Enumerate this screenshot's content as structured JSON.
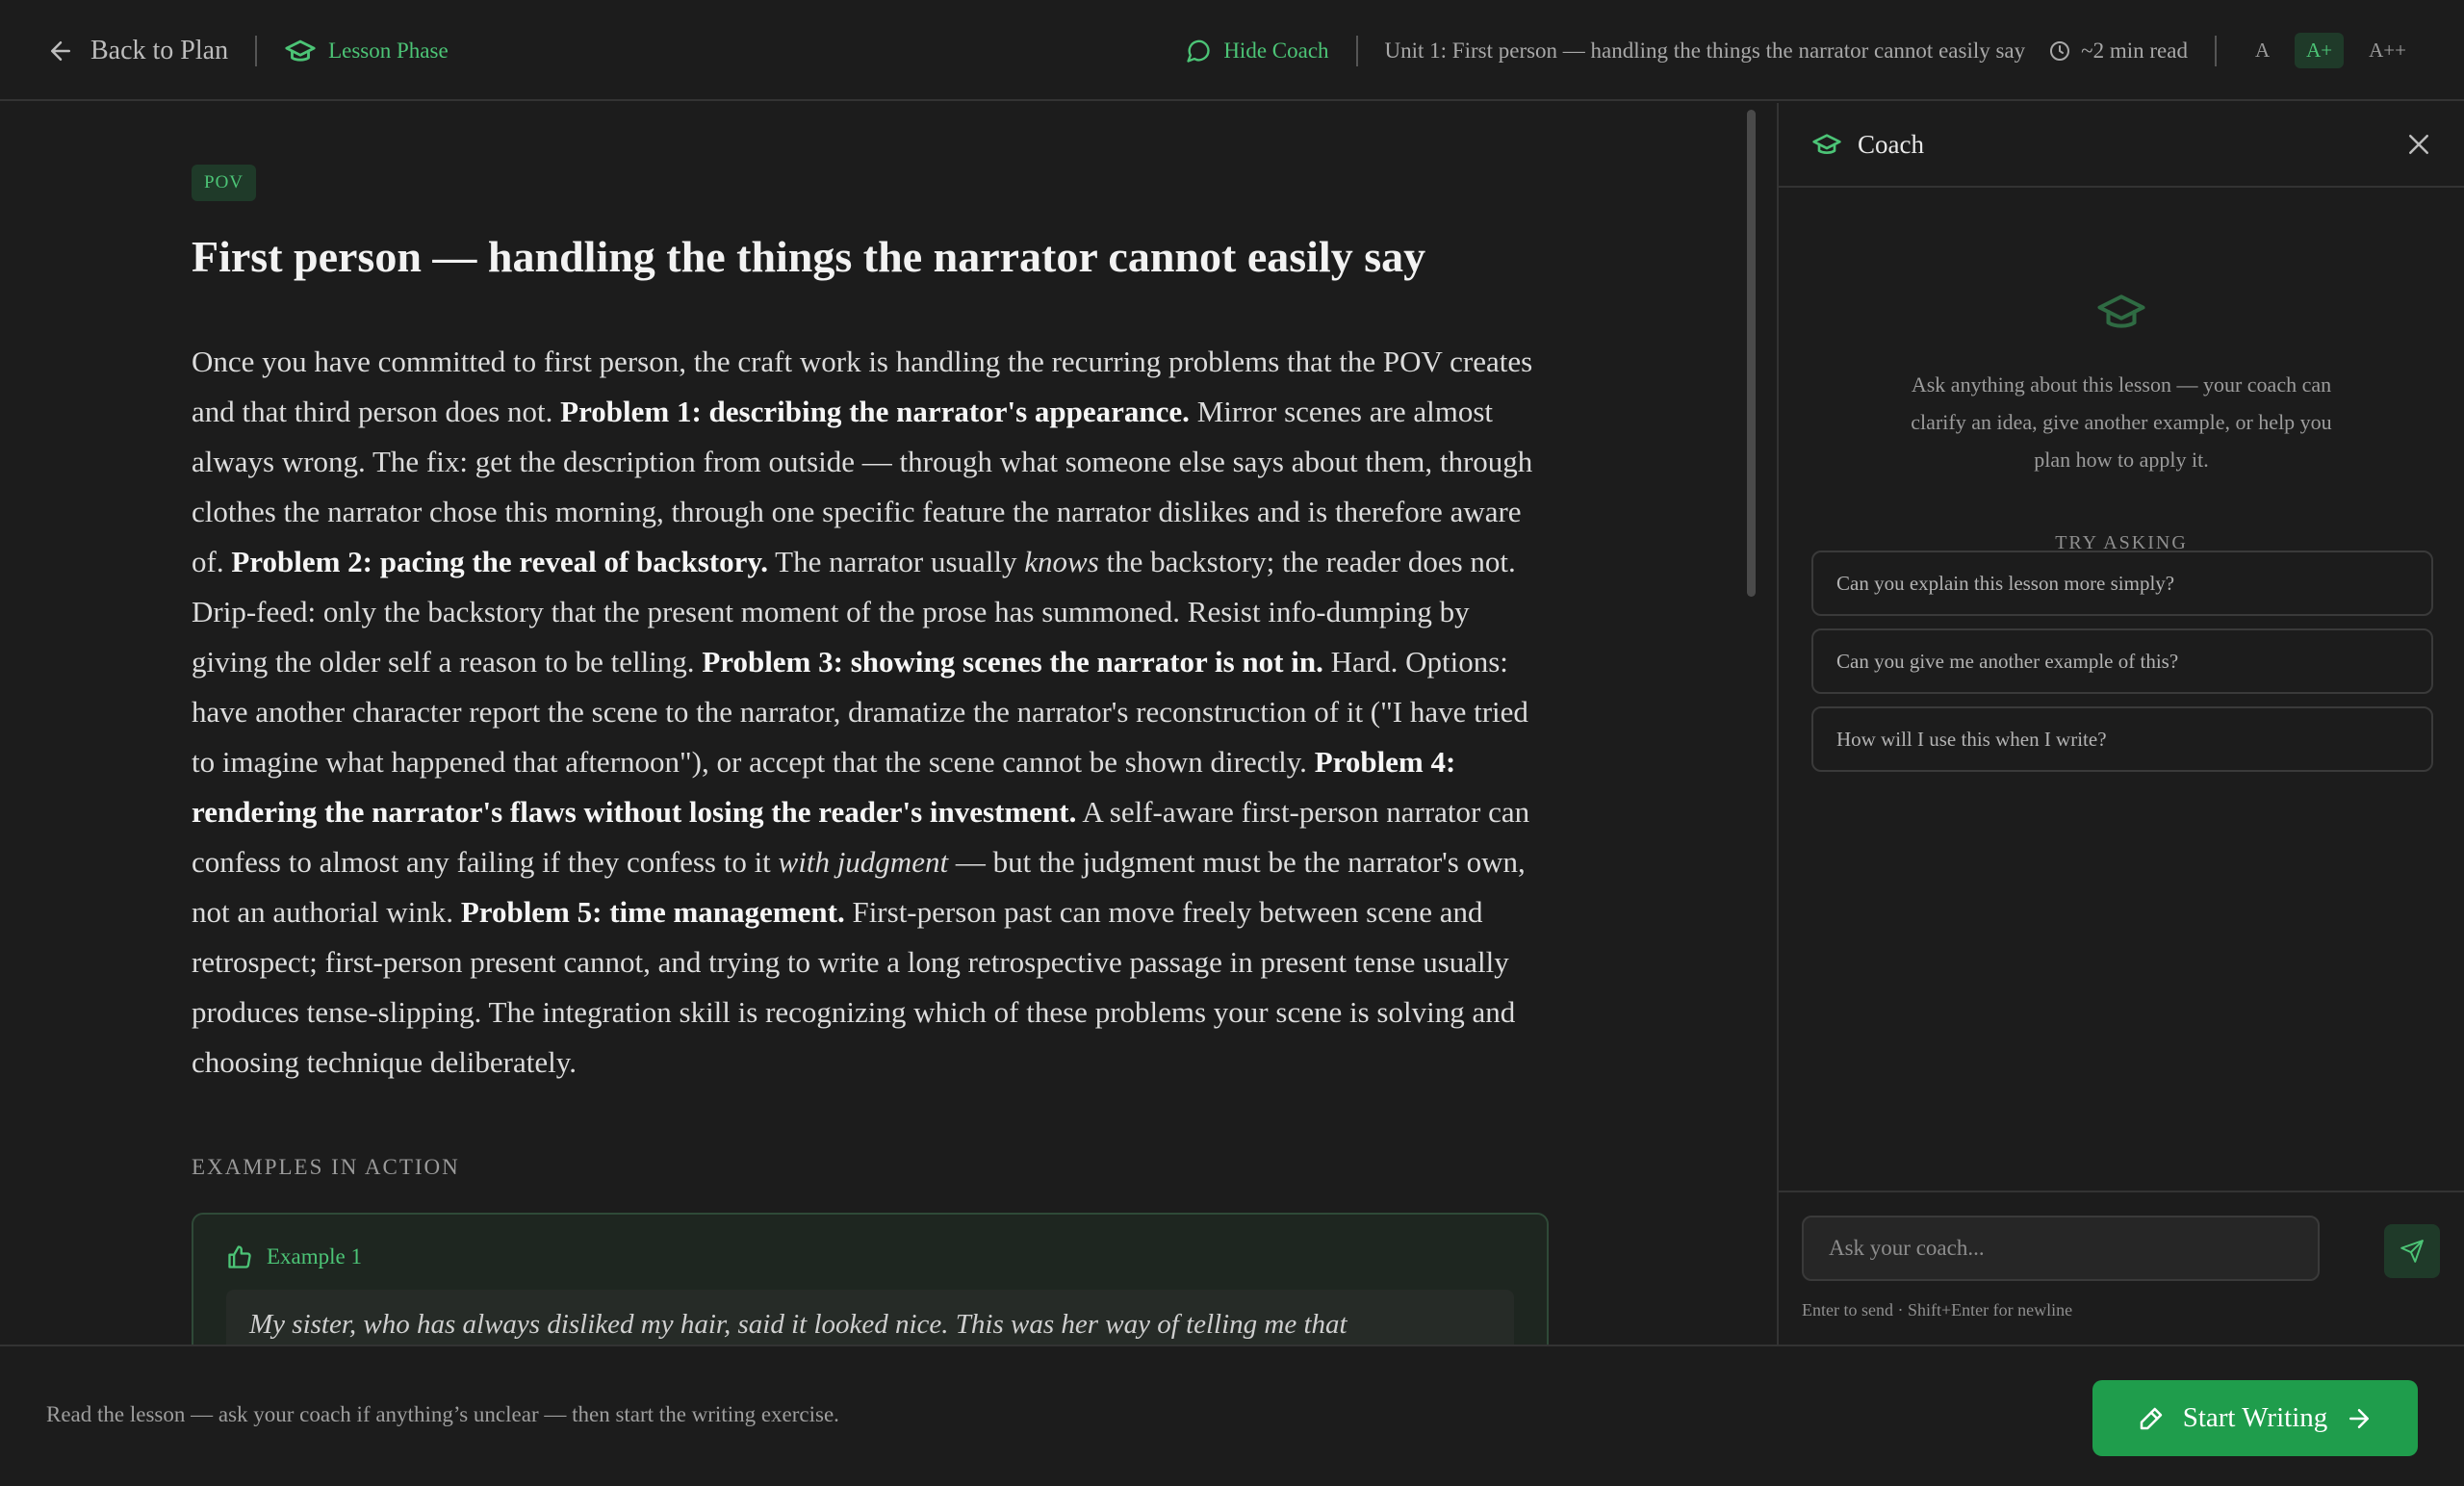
{
  "header": {
    "back_label": "Back to Plan",
    "phase_label": "Lesson Phase",
    "hide_coach_label": "Hide Coach",
    "unit_title": "Unit 1: First person — handling the things the narrator cannot easily say",
    "read_time": "~2 min read",
    "font_sizes": [
      "A",
      "A+",
      "A++"
    ],
    "active_font_size": "A+"
  },
  "lesson": {
    "tag": "POV",
    "title": "First person — handling the things the narrator cannot easily say",
    "body": [
      {
        "t": "Once you have committed to first person, the craft work is handling the recurring problems that the POV creates and that third person does not. "
      },
      {
        "t": "Problem 1: describing the narrator's appearance.",
        "b": true
      },
      {
        "t": " Mirror scenes are almost always wrong. The fix: get the description from outside — through what someone else says about them, through clothes the narrator chose this morning, through one specific feature the narrator dislikes and is therefore aware of. "
      },
      {
        "t": "Problem 2: pacing the reveal of backstory.",
        "b": true
      },
      {
        "t": " The narrator usually "
      },
      {
        "t": "knows",
        "i": true
      },
      {
        "t": " the backstory; the reader does not. Drip-feed: only the backstory that the present moment of the prose has summoned. Resist info-dumping by giving the older self a reason to be telling. "
      },
      {
        "t": "Problem 3: showing scenes the narrator is not in.",
        "b": true
      },
      {
        "t": " Hard. Options: have another character report the scene to the narrator, dramatize the narrator's reconstruction of it (\"I have tried to imagine what happened that afternoon\"), or accept that the scene cannot be shown directly. "
      },
      {
        "t": "Problem 4: rendering the narrator's flaws without losing the reader's investment.",
        "b": true
      },
      {
        "t": " A self-aware first-person narrator can confess to almost any failing if they confess to it "
      },
      {
        "t": "with judgment",
        "i": true
      },
      {
        "t": " — but the judgment must be the narrator's own, not an authorial wink. "
      },
      {
        "t": "Problem 5: time management.",
        "b": true
      },
      {
        "t": " First-person past can move freely between scene and retrospect; first-person present cannot, and trying to write a long retrospective passage in present tense usually produces tense-slipping. The integration skill is recognizing which of these problems your scene is solving and choosing technique deliberately."
      }
    ],
    "examples_heading": "EXAMPLES IN ACTION",
    "example_label": "Example 1",
    "example_quote": "My sister, who has always disliked my hair, said it looked nice. This was her way of telling me that"
  },
  "coach": {
    "title": "Coach",
    "description": "Ask anything about this lesson — your coach can clarify an idea, give another example, or help you plan how to apply it.",
    "try_label": "TRY ASKING",
    "suggestions": [
      "Can you explain this lesson more simply?",
      "Can you give me another example of this?",
      "How will I use this when I write?"
    ],
    "input_placeholder": "Ask your coach...",
    "hint": "Enter to send · Shift+Enter for newline"
  },
  "footer": {
    "message": "Read the lesson — ask your coach if anything’s unclear — then start the writing exercise.",
    "start_label": "Start Writing"
  },
  "colors": {
    "accent": "#4cc476",
    "button_green": "#1f9d4c",
    "background": "#1c1c1c"
  },
  "icons": {
    "back": "arrow-left-icon",
    "phase": "graduation-cap-icon",
    "hide_coach": "chat-bubble-icon",
    "read_time": "clock-icon",
    "close": "close-icon",
    "example": "thumbs-up-icon",
    "send": "send-icon",
    "start": "pen-icon"
  }
}
